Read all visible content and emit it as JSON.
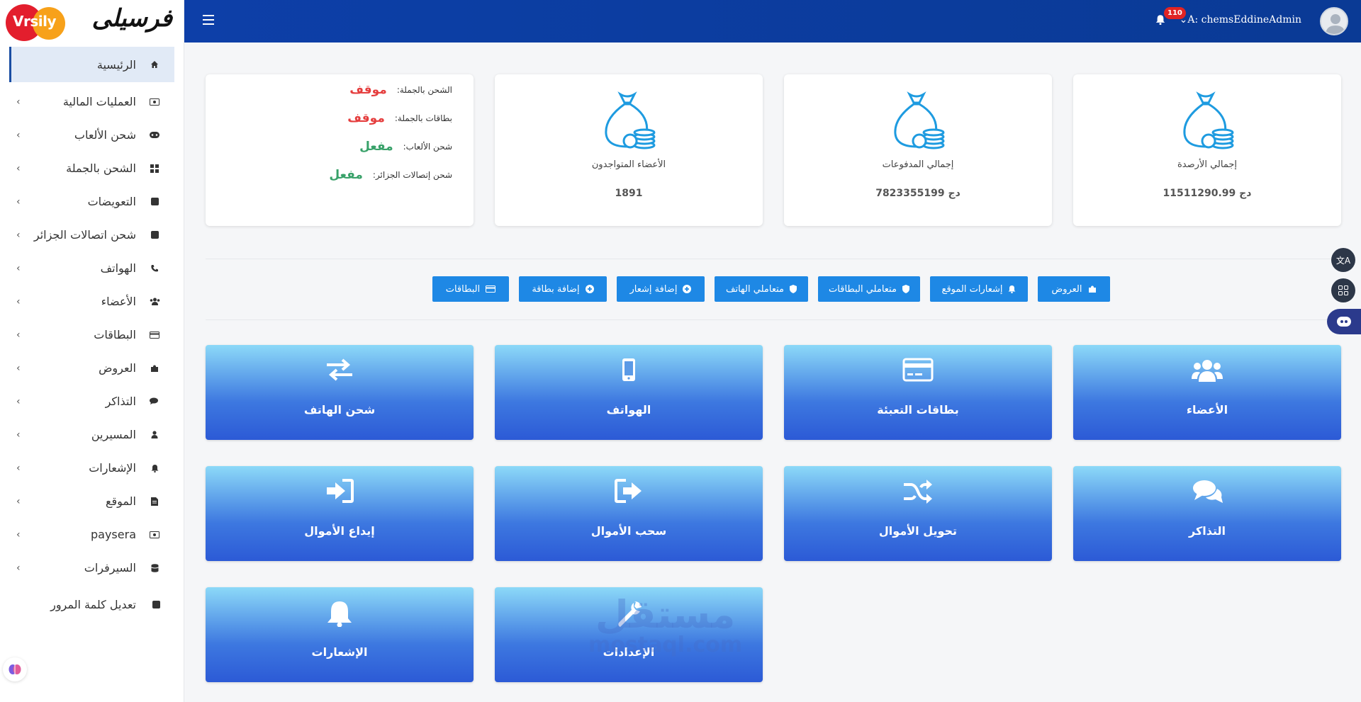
{
  "brand": {
    "name": "فرسيلى",
    "badge": "Vrsily"
  },
  "topbar": {
    "notifications_count": "110",
    "user": "A: chemsEddineAdmin"
  },
  "sidebar": {
    "items": [
      {
        "label": "الرئيسية",
        "icon": "home-icon"
      },
      {
        "label": "العمليات المالية",
        "icon": "money-icon"
      },
      {
        "label": "شحن الألعاب",
        "icon": "gamepad-icon"
      },
      {
        "label": "الشحن بالجملة",
        "icon": "grid-icon"
      },
      {
        "label": "التعويضات",
        "icon": "square-icon"
      },
      {
        "label": "شحن اتصالات الجزائر",
        "icon": "square-icon"
      },
      {
        "label": "الهواتف",
        "icon": "phone-icon"
      },
      {
        "label": "الأعضاء",
        "icon": "users-icon"
      },
      {
        "label": "البطاقات",
        "icon": "credit-card-icon"
      },
      {
        "label": "العروض",
        "icon": "puzzle-icon"
      },
      {
        "label": "التذاكر",
        "icon": "comments-icon"
      },
      {
        "label": "المسيرين",
        "icon": "user-icon"
      },
      {
        "label": "الإشعارات",
        "icon": "bell-icon"
      },
      {
        "label": "الموقع",
        "icon": "file-icon"
      },
      {
        "label": "paysera",
        "icon": "money-icon"
      },
      {
        "label": "السيرفرات",
        "icon": "database-icon"
      },
      {
        "label": "تعديل كلمة المرور",
        "icon": "square-icon"
      }
    ]
  },
  "stats": [
    {
      "label": "إجمالي الأرصدة",
      "value": "11511290.99 دج"
    },
    {
      "label": "إجمالي المدفوعات",
      "value": "7823355199 دج"
    },
    {
      "label": "الأعضاء المتواجدون",
      "value": "1891"
    }
  ],
  "status": [
    {
      "key": "الشحن بالجملة:",
      "value": "موقف",
      "color": "#e53e3e"
    },
    {
      "key": "بطاقات بالجملة:",
      "value": "موقف",
      "color": "#e53e3e"
    },
    {
      "key": "شحن الألعاب:",
      "value": "مفعل",
      "color": "#38a169"
    },
    {
      "key": "شحن إتصالات الجزائر:",
      "value": "مفعل",
      "color": "#38a169"
    }
  ],
  "quick_buttons": [
    {
      "label": "العروض",
      "icon": "puzzle-icon"
    },
    {
      "label": "إشعارات الموقع",
      "icon": "bell-icon"
    },
    {
      "label": "متعاملي البطاقات",
      "icon": "shield-icon"
    },
    {
      "label": "متعاملي الهاتف",
      "icon": "shield-icon"
    },
    {
      "label": "إضافة إشعار",
      "icon": "plus-circle-icon"
    },
    {
      "label": "إضافة بطاقة",
      "icon": "plus-circle-icon"
    },
    {
      "label": "البطاقات",
      "icon": "credit-card-icon"
    }
  ],
  "tiles": [
    {
      "label": "الأعضاء",
      "icon": "users-icon"
    },
    {
      "label": "بطاقات التعبئة",
      "icon": "credit-card-icon"
    },
    {
      "label": "الهواتف",
      "icon": "mobile-icon"
    },
    {
      "label": "شحن الهاتف",
      "icon": "exchange-icon"
    },
    {
      "label": "التذاكر",
      "icon": "comments-icon"
    },
    {
      "label": "تحويل الأموال",
      "icon": "shuffle-icon"
    },
    {
      "label": "سحب الأموال",
      "icon": "sign-out-icon"
    },
    {
      "label": "إيداع الأموال",
      "icon": "sign-in-icon"
    },
    {
      "label": "الإشعارات",
      "icon": "bell-icon"
    },
    {
      "label": "الإعدادات",
      "icon": "wrench-icon"
    }
  ],
  "watermark": {
    "line1": "مستقل",
    "line2": "mostaql.com"
  },
  "colors": {
    "topbar": "#0d3fa8",
    "tile_top": "#8cd9f8",
    "tile_bottom": "#2c5ad6",
    "quick_button": "#1e88e5",
    "stopped": "#e53e3e",
    "active": "#38a169"
  }
}
